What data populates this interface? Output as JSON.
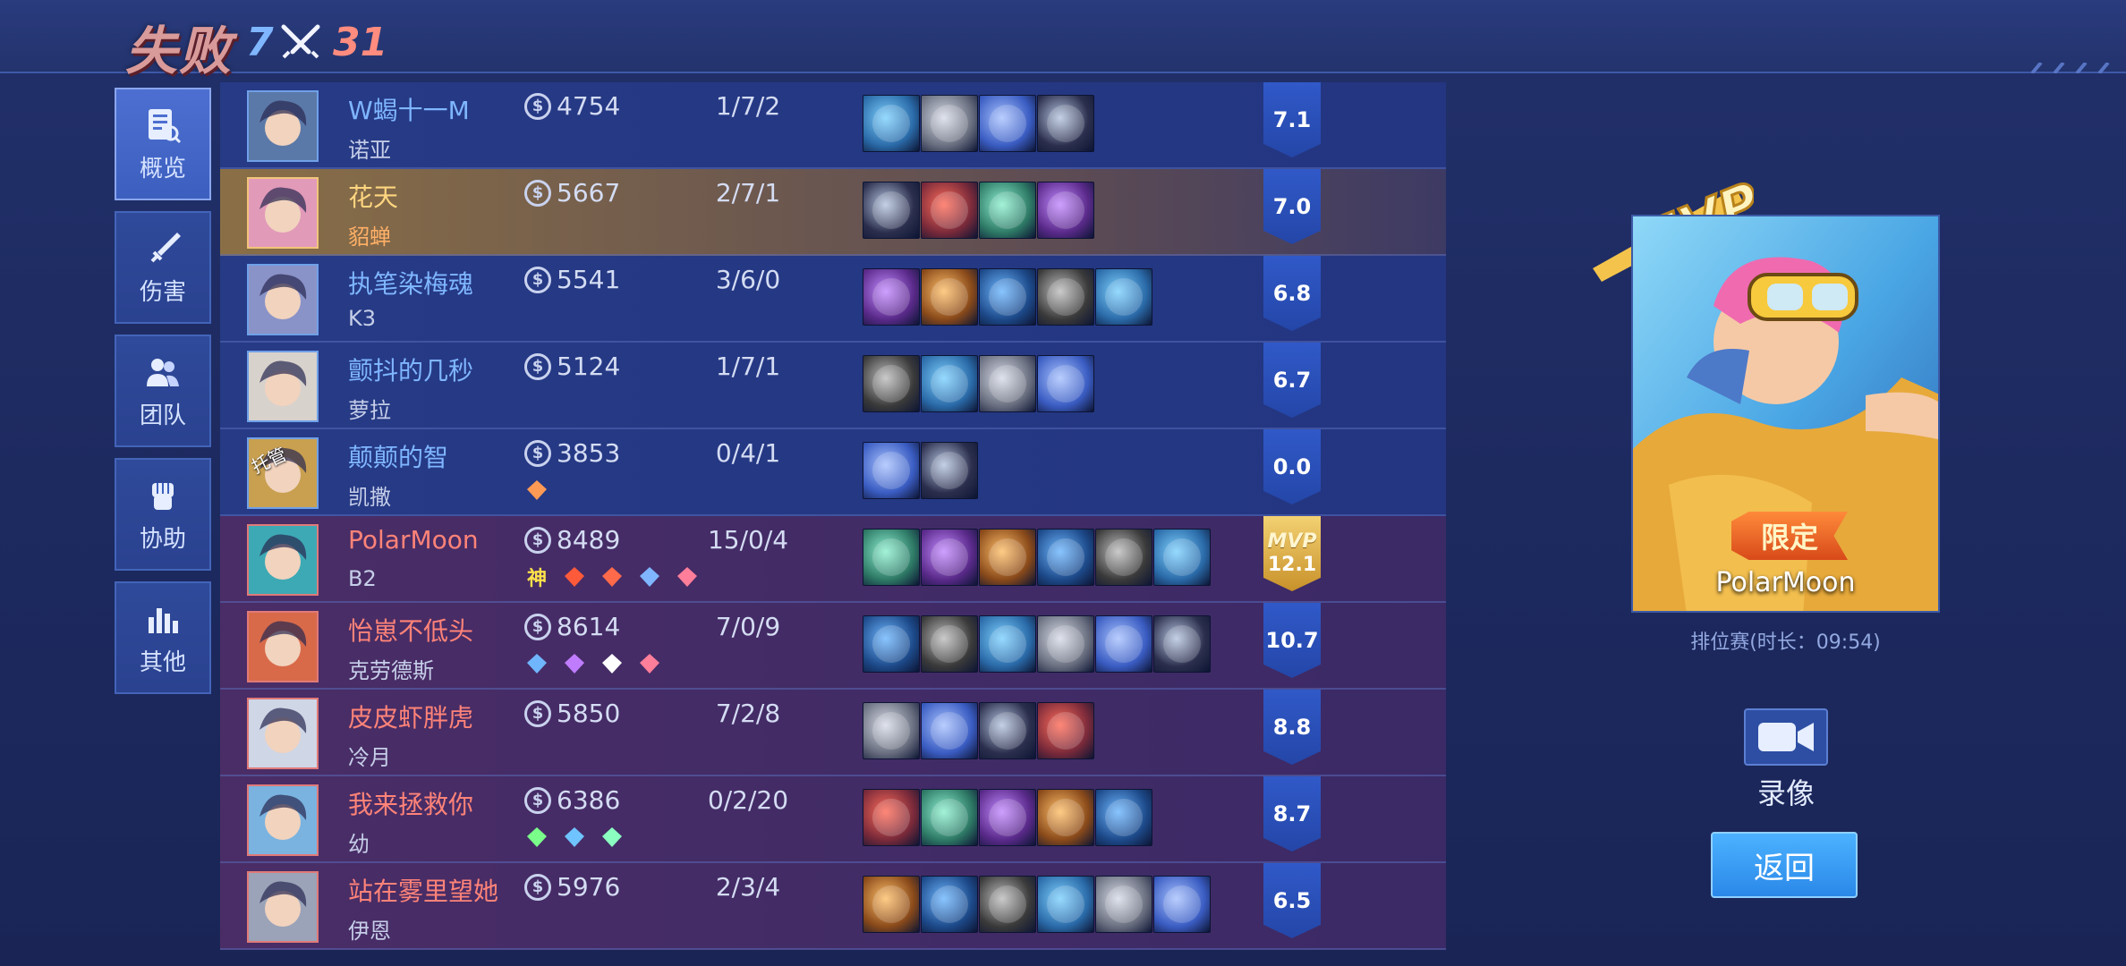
{
  "header": {
    "result": "失败",
    "team_kills": "7",
    "enemy_kills": "31"
  },
  "nav": [
    {
      "label": "概览",
      "icon": "overview-icon",
      "active": true
    },
    {
      "label": "伤害",
      "icon": "sword-icon",
      "active": false
    },
    {
      "label": "团队",
      "icon": "team-icon",
      "active": false
    },
    {
      "label": "协助",
      "icon": "fist-icon",
      "active": false
    },
    {
      "label": "其他",
      "icon": "bar-chart-icon",
      "active": false
    }
  ],
  "players": [
    {
      "team": "blue",
      "name": "W蝎十一M",
      "hero": "诺亚",
      "gold": "4754",
      "kda": "1/7/2",
      "rating": "7.1",
      "items": 4
    },
    {
      "team": "blue",
      "name": "花天",
      "hero": "貂蝉",
      "gold": "5667",
      "kda": "2/7/1",
      "rating": "7.0",
      "items": 4,
      "self": true
    },
    {
      "team": "blue",
      "name": "执笔染梅魂",
      "hero": "K3",
      "gold": "5541",
      "kda": "3/6/0",
      "rating": "6.8",
      "items": 5
    },
    {
      "team": "blue",
      "name": "颤抖的几秒",
      "hero": "萝拉",
      "gold": "5124",
      "kda": "1/7/1",
      "rating": "6.7",
      "items": 4
    },
    {
      "team": "blue",
      "name": "颠颠的智",
      "hero": "凯撒",
      "gold": "3853",
      "kda": "0/4/1",
      "rating": "0.0",
      "items": 2,
      "hosted": "托管",
      "badges": [
        "flag-icon"
      ]
    },
    {
      "team": "red",
      "name": "PolarMoon",
      "hero": "B2",
      "gold": "8489",
      "kda": "15/0/4",
      "rating": "12.1",
      "mvp": "MVP",
      "items": 6,
      "badges": [
        "god-badge",
        "fire-icon",
        "rocket-icon",
        "assist-icon",
        "heart-icon"
      ],
      "god_text": "神"
    },
    {
      "team": "red",
      "name": "怡崽不低头",
      "hero": "克劳德斯",
      "gold": "8614",
      "kda": "7/0/9",
      "rating": "10.7",
      "items": 6,
      "badges": [
        "shield-icon",
        "tower-icon",
        "coin-icon",
        "heart-icon"
      ]
    },
    {
      "team": "red",
      "name": "皮皮虾胖虎",
      "hero": "冷月",
      "gold": "5850",
      "kda": "7/2/8",
      "rating": "8.8",
      "items": 4
    },
    {
      "team": "red",
      "name": "我来拯救你",
      "hero": "幼",
      "gold": "6386",
      "kda": "0/2/20",
      "rating": "8.7",
      "items": 5,
      "badges": [
        "fist-icon",
        "eye-icon",
        "potion-icon"
      ]
    },
    {
      "team": "red",
      "name": "站在雾里望她",
      "hero": "伊恩",
      "gold": "5976",
      "kda": "2/3/4",
      "rating": "6.5",
      "items": 6
    }
  ],
  "mvp_card": {
    "logo": "MVP",
    "limited": "限定",
    "player": "PolarMoon",
    "match_info": "排位赛(时长：09:54)"
  },
  "actions": {
    "video_label": "录像",
    "back_label": "返回"
  },
  "colors": {
    "blue_team_name": "#7fb6ff",
    "red_team_name": "#ff8378",
    "self_name": "#ffd680",
    "rating_blue": "#2f58c6",
    "mvp_gold": "#e6b54a"
  }
}
